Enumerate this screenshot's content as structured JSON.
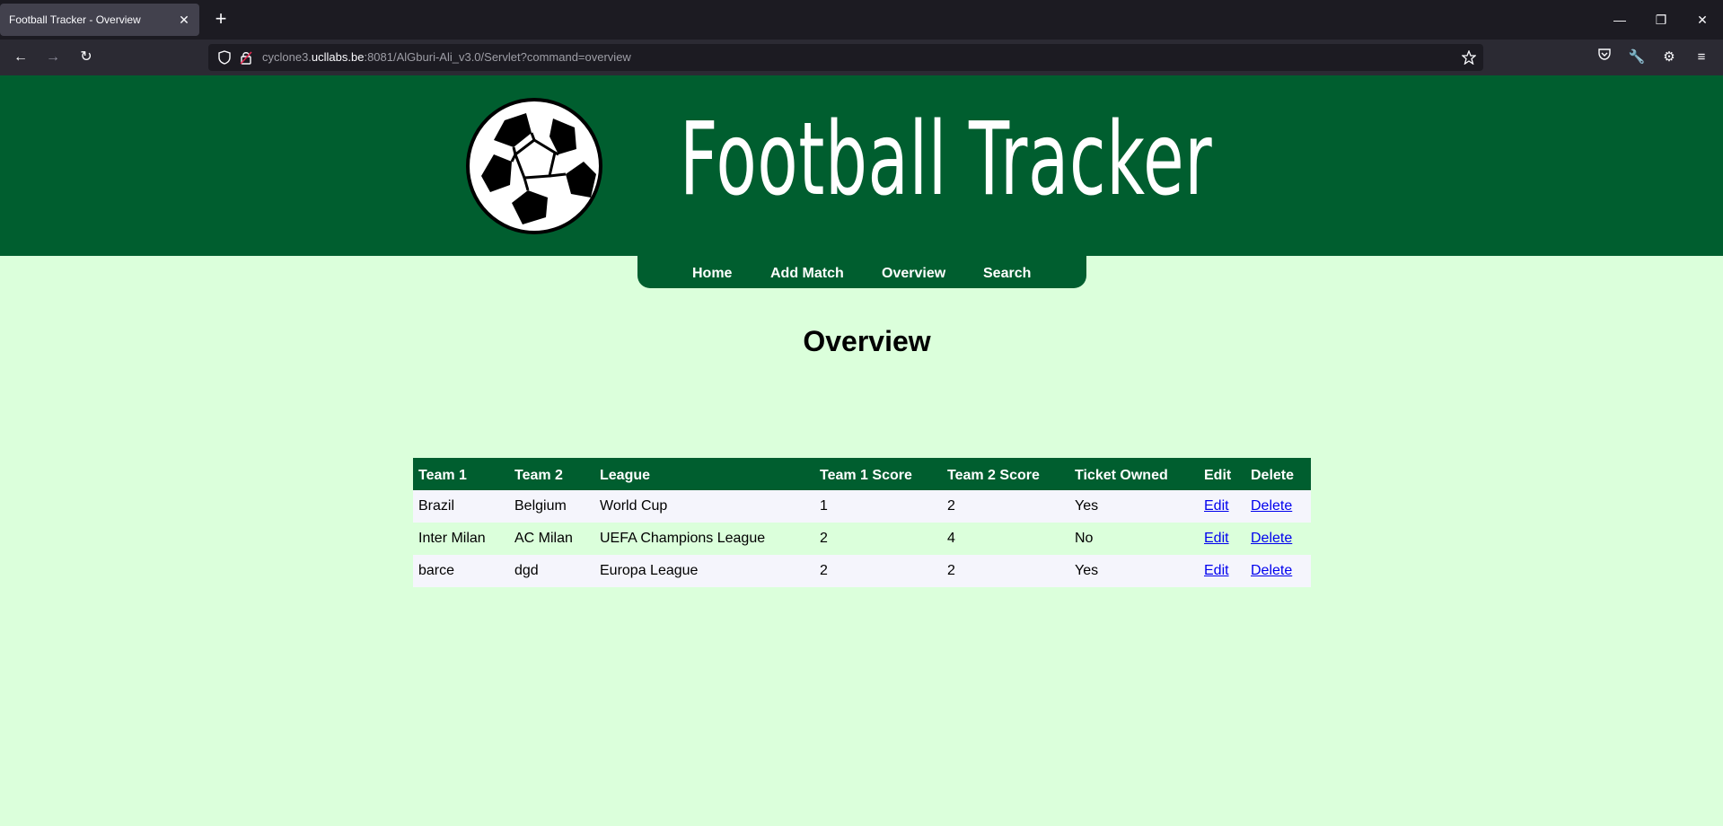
{
  "browser": {
    "tab_title": "Football Tracker - Overview",
    "url_prefix": "cyclone3.",
    "url_host": "ucllabs.be",
    "url_rest": ":8081/AlGburi-Ali_v3.0/Servlet?command=overview"
  },
  "site": {
    "title": "Football Tracker",
    "logo": "soccer-ball-logo"
  },
  "nav": {
    "items": [
      "Home",
      "Add Match",
      "Overview",
      "Search"
    ]
  },
  "page": {
    "heading": "Overview"
  },
  "table": {
    "headers": [
      "Team 1",
      "Team 2",
      "League",
      "Team 1 Score",
      "Team 2 Score",
      "Ticket Owned",
      "Edit",
      "Delete"
    ],
    "rows": [
      {
        "team1": "Brazil",
        "team2": "Belgium",
        "league": "World Cup",
        "score1": "1",
        "score2": "2",
        "ticket": "Yes",
        "edit": "Edit",
        "delete": "Delete"
      },
      {
        "team1": "Inter Milan",
        "team2": "AC Milan",
        "league": "UEFA Champions League",
        "score1": "2",
        "score2": "4",
        "ticket": "No",
        "edit": "Edit",
        "delete": "Delete"
      },
      {
        "team1": "barce",
        "team2": "dgd",
        "league": "Europa League",
        "score1": "2",
        "score2": "2",
        "ticket": "Yes",
        "edit": "Edit",
        "delete": "Delete"
      }
    ]
  },
  "colors": {
    "header_green": "#005e2f",
    "page_background": "#dbffdb",
    "row_light": "#f5f5fc",
    "link": "#0000ee"
  },
  "icons": {
    "toolbar_left": [
      "back-arrow-icon",
      "forward-arrow-icon",
      "reload-icon"
    ],
    "url": [
      "shield-icon",
      "lock-icon",
      "star-icon"
    ],
    "toolbar_right": [
      "pocket-icon",
      "wrench-icon",
      "extensions-icon",
      "menu-icon"
    ],
    "window": [
      "minimize-icon",
      "restore-icon",
      "close-icon"
    ]
  }
}
